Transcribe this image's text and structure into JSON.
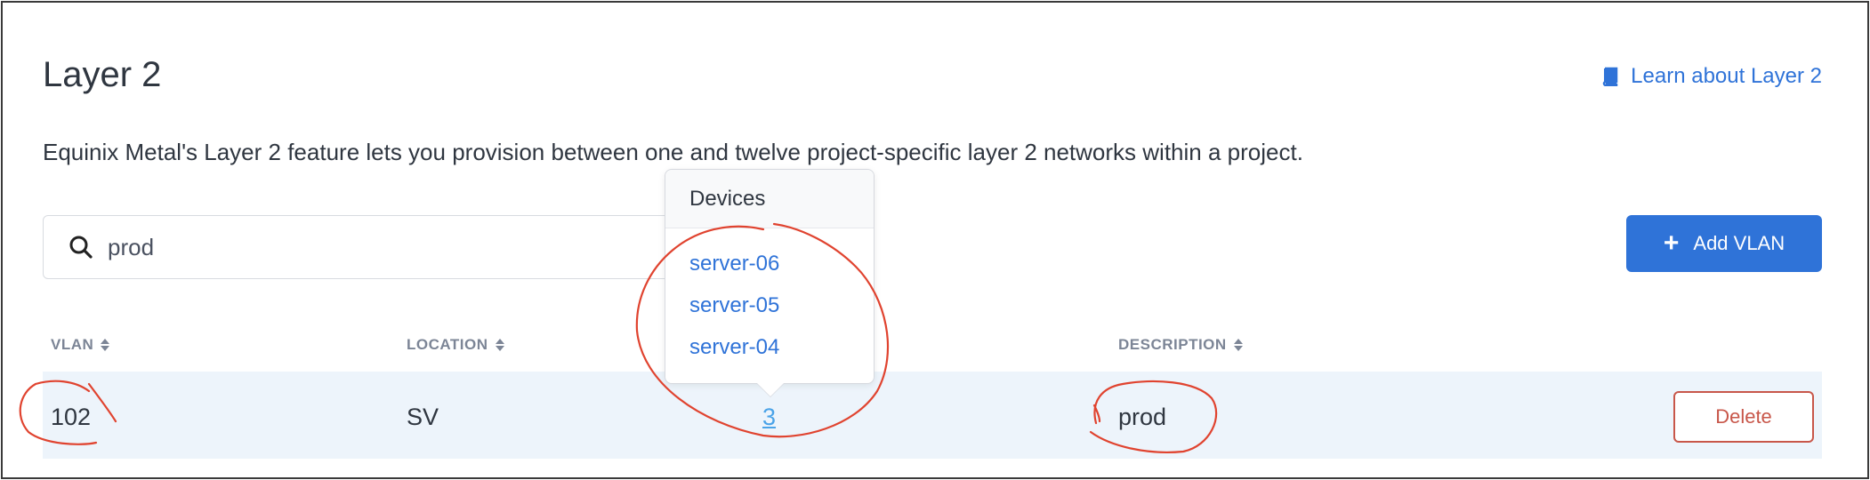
{
  "page": {
    "title": "Layer 2",
    "learn_link": "Learn about Layer 2",
    "description": "Equinix Metal's Layer 2 feature lets you provision between one and twelve project-specific layer 2 networks within a project."
  },
  "search": {
    "value": "prod"
  },
  "toolbar": {
    "add_label": "Add VLAN"
  },
  "table": {
    "headers": [
      "VLAN",
      "LOCATION",
      "DESCRIPTION"
    ],
    "rows": [
      {
        "vlan": "102",
        "location": "SV",
        "devices_count": "3",
        "description": "prod",
        "delete_label": "Delete"
      }
    ]
  },
  "popover": {
    "title": "Devices",
    "items": [
      "server-06",
      "server-05",
      "server-04"
    ]
  },
  "colors": {
    "accent": "#2f73d8",
    "danger": "#c8574a",
    "row_highlight": "#edf4fb",
    "annotation": "#e0432f"
  }
}
